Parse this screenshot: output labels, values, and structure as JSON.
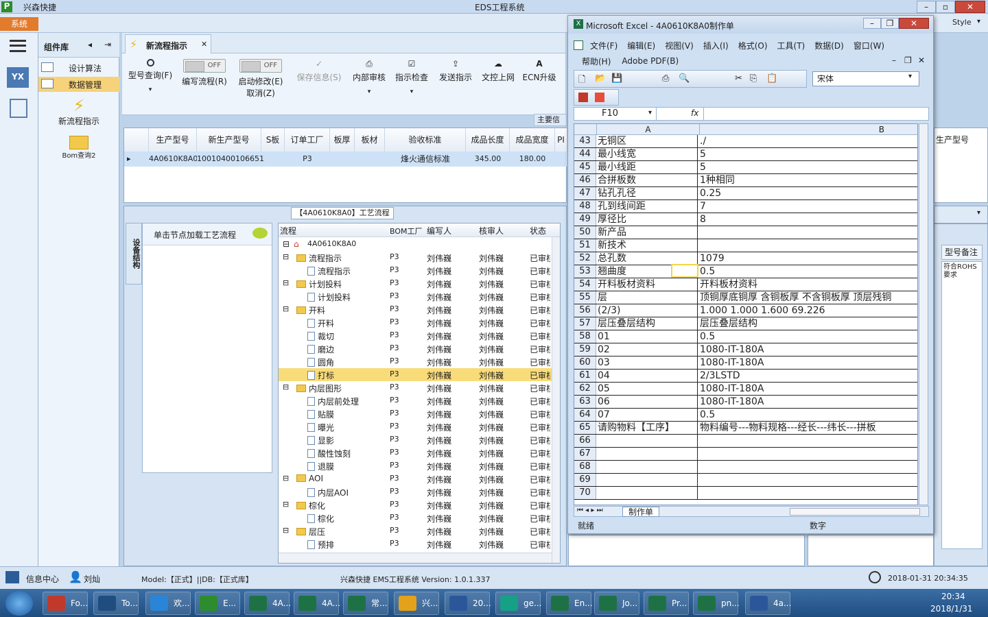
{
  "window": {
    "app_name": "兴森快捷",
    "title": "EDS工程系统",
    "style_label": "Style"
  },
  "menu": {
    "system": "系统"
  },
  "complib": {
    "title": "组件库",
    "items": [
      "设计算法",
      "数据管理"
    ],
    "tools": [
      "新流程指示",
      "Bom查询2"
    ]
  },
  "tab": {
    "label": "新流程指示"
  },
  "ribbon": {
    "model_query": "型号查询(F)",
    "edit_flow": "编写流程(R)",
    "enable_modify": "启动修改(E)",
    "cancel": "取消(Z)",
    "off": "OFF",
    "save_info": "保存信息(S)",
    "internal_review": "内部审核",
    "indicate_check": "指示检查",
    "send_indication": "发送指示",
    "upload_doc": "文控上网",
    "ecn_upgrade": "ECN升级",
    "main_info": "主要信"
  },
  "top_grid": {
    "headers": [
      "生产型号",
      "新生产型号",
      "S板",
      "订单工厂",
      "板厚",
      "板材",
      "验收标准",
      "成品长度",
      "成品宽度",
      "PI"
    ],
    "row": [
      "4A0610K8A0",
      "10010400106651",
      "",
      "P3",
      "",
      "",
      "烽火通信标准",
      "345.00",
      "180.00",
      ""
    ]
  },
  "flow_panel": {
    "caption": "【4A0610K8A0】工艺流程",
    "side_tab": "设备结构",
    "hint": "单击节点加载工艺流程",
    "headers": [
      "流程",
      "BOM工厂",
      "编写人",
      "核审人",
      "状态"
    ],
    "root": "4A0610K8A0",
    "rows": [
      {
        "level": 1,
        "type": "folder",
        "name": "流程指示"
      },
      {
        "level": 2,
        "type": "doc",
        "name": "流程指示"
      },
      {
        "level": 1,
        "type": "folder",
        "name": "计划投料"
      },
      {
        "level": 2,
        "type": "doc",
        "name": "计划投料"
      },
      {
        "level": 1,
        "type": "folder",
        "name": "开料"
      },
      {
        "level": 2,
        "type": "doc",
        "name": "开料"
      },
      {
        "level": 2,
        "type": "doc",
        "name": "裁切"
      },
      {
        "level": 2,
        "type": "doc",
        "name": "磨边"
      },
      {
        "level": 2,
        "type": "doc",
        "name": "圆角"
      },
      {
        "level": 2,
        "type": "doc",
        "name": "打标",
        "selected": true
      },
      {
        "level": 1,
        "type": "folder",
        "name": "内层图形"
      },
      {
        "level": 2,
        "type": "doc",
        "name": "内层前处理"
      },
      {
        "level": 2,
        "type": "doc",
        "name": "贴膜"
      },
      {
        "level": 2,
        "type": "doc",
        "name": "曝光"
      },
      {
        "level": 2,
        "type": "doc",
        "name": "显影"
      },
      {
        "level": 2,
        "type": "doc",
        "name": "酸性蚀刻"
      },
      {
        "level": 2,
        "type": "doc",
        "name": "退膜"
      },
      {
        "level": 1,
        "type": "folder",
        "name": "AOI"
      },
      {
        "level": 2,
        "type": "doc",
        "name": "内层AOI"
      },
      {
        "level": 1,
        "type": "folder",
        "name": "棕化"
      },
      {
        "level": 2,
        "type": "doc",
        "name": "棕化"
      },
      {
        "level": 1,
        "type": "folder",
        "name": "层压"
      },
      {
        "level": 2,
        "type": "doc",
        "name": "预排"
      }
    ],
    "factory": "P3",
    "writer": "刘伟巍",
    "reviewer": "刘伟巍",
    "status": "已审核"
  },
  "excel": {
    "title": "Microsoft Excel - 4A0610K8A0制作单",
    "menu": [
      "文件(F)",
      "编辑(E)",
      "视图(V)",
      "插入(I)",
      "格式(O)",
      "工具(T)",
      "数据(D)",
      "窗口(W)"
    ],
    "menu2": [
      "帮助(H)",
      "Adobe PDF(B)"
    ],
    "font": "宋体",
    "cell_ref": "F10",
    "fx": "fx",
    "col_a": "A",
    "col_b": "B",
    "rows": [
      {
        "n": "43",
        "a": "无铜区",
        "b": "./"
      },
      {
        "n": "44",
        "a": "最小线宽",
        "b": "5"
      },
      {
        "n": "45",
        "a": "最小线距",
        "b": "5"
      },
      {
        "n": "46",
        "a": "合拼板数",
        "b": "1种相同"
      },
      {
        "n": "47",
        "a": "钻孔孔径",
        "b": "0.25"
      },
      {
        "n": "48",
        "a": "孔到线间距",
        "b": "7"
      },
      {
        "n": "49",
        "a": "厚径比",
        "b": "8"
      },
      {
        "n": "50",
        "a": "新产品",
        "b": ""
      },
      {
        "n": "51",
        "a": "新技术",
        "b": ""
      },
      {
        "n": "52",
        "a": "总孔数",
        "b": "1079"
      },
      {
        "n": "53",
        "a": "翘曲度",
        "b": "0.5"
      },
      {
        "n": "54",
        "a": "开料板材资料",
        "b": "开料板材资料"
      },
      {
        "n": "55",
        "a": "层",
        "b": "顶铜厚底铜厚 含铜板厚 不含铜板厚 顶层残铜"
      },
      {
        "n": "56",
        "a": "(2/3)",
        "b": "1.000  1.000   1.600            69.226"
      },
      {
        "n": "57",
        "a": "层压叠层结构",
        "b": "层压叠层结构"
      },
      {
        "n": "58",
        "a": "01",
        "b": "0.5"
      },
      {
        "n": "59",
        "a": "02",
        "b": "1080-IT-180A"
      },
      {
        "n": "60",
        "a": "03",
        "b": "1080-IT-180A"
      },
      {
        "n": "61",
        "a": "04",
        "b": "2/3LSTD"
      },
      {
        "n": "62",
        "a": "05",
        "b": "1080-IT-180A"
      },
      {
        "n": "63",
        "a": "06",
        "b": "1080-IT-180A"
      },
      {
        "n": "64",
        "a": "07",
        "b": "0.5"
      },
      {
        "n": "65",
        "a": "请购物料【工序】",
        "b": "物料编号---物料规格---经长---纬长---拼板"
      },
      {
        "n": "66",
        "a": "",
        "b": ""
      },
      {
        "n": "67",
        "a": "",
        "b": ""
      },
      {
        "n": "68",
        "a": "",
        "b": ""
      },
      {
        "n": "69",
        "a": "",
        "b": ""
      },
      {
        "n": "70",
        "a": "",
        "b": ""
      }
    ],
    "sheet_tab": "制作单",
    "status": "就绪",
    "num_mode": "数字"
  },
  "right_panel": {
    "header": "生产型号",
    "note_header": "型号备注",
    "note_text": "符合ROHS要求"
  },
  "statusbar": {
    "info_center": "信息中心",
    "user": "刘灿",
    "model": "Model:【正式】||DB:【正式库】",
    "system_name": "兴森快捷 EMS工程系统  Version: 1.0.1.337",
    "datetime": "2018-01-31 20:34:35"
  },
  "taskbar": {
    "items": [
      "Fo...",
      "To...",
      "欢...",
      "E...",
      "4A...",
      "4A...",
      "常...",
      "兴...",
      "20...",
      "ge...",
      "En...",
      "Jo...",
      "Pr...",
      "pn...",
      "4a..."
    ],
    "time": "20:34",
    "date": "2018/1/31"
  }
}
